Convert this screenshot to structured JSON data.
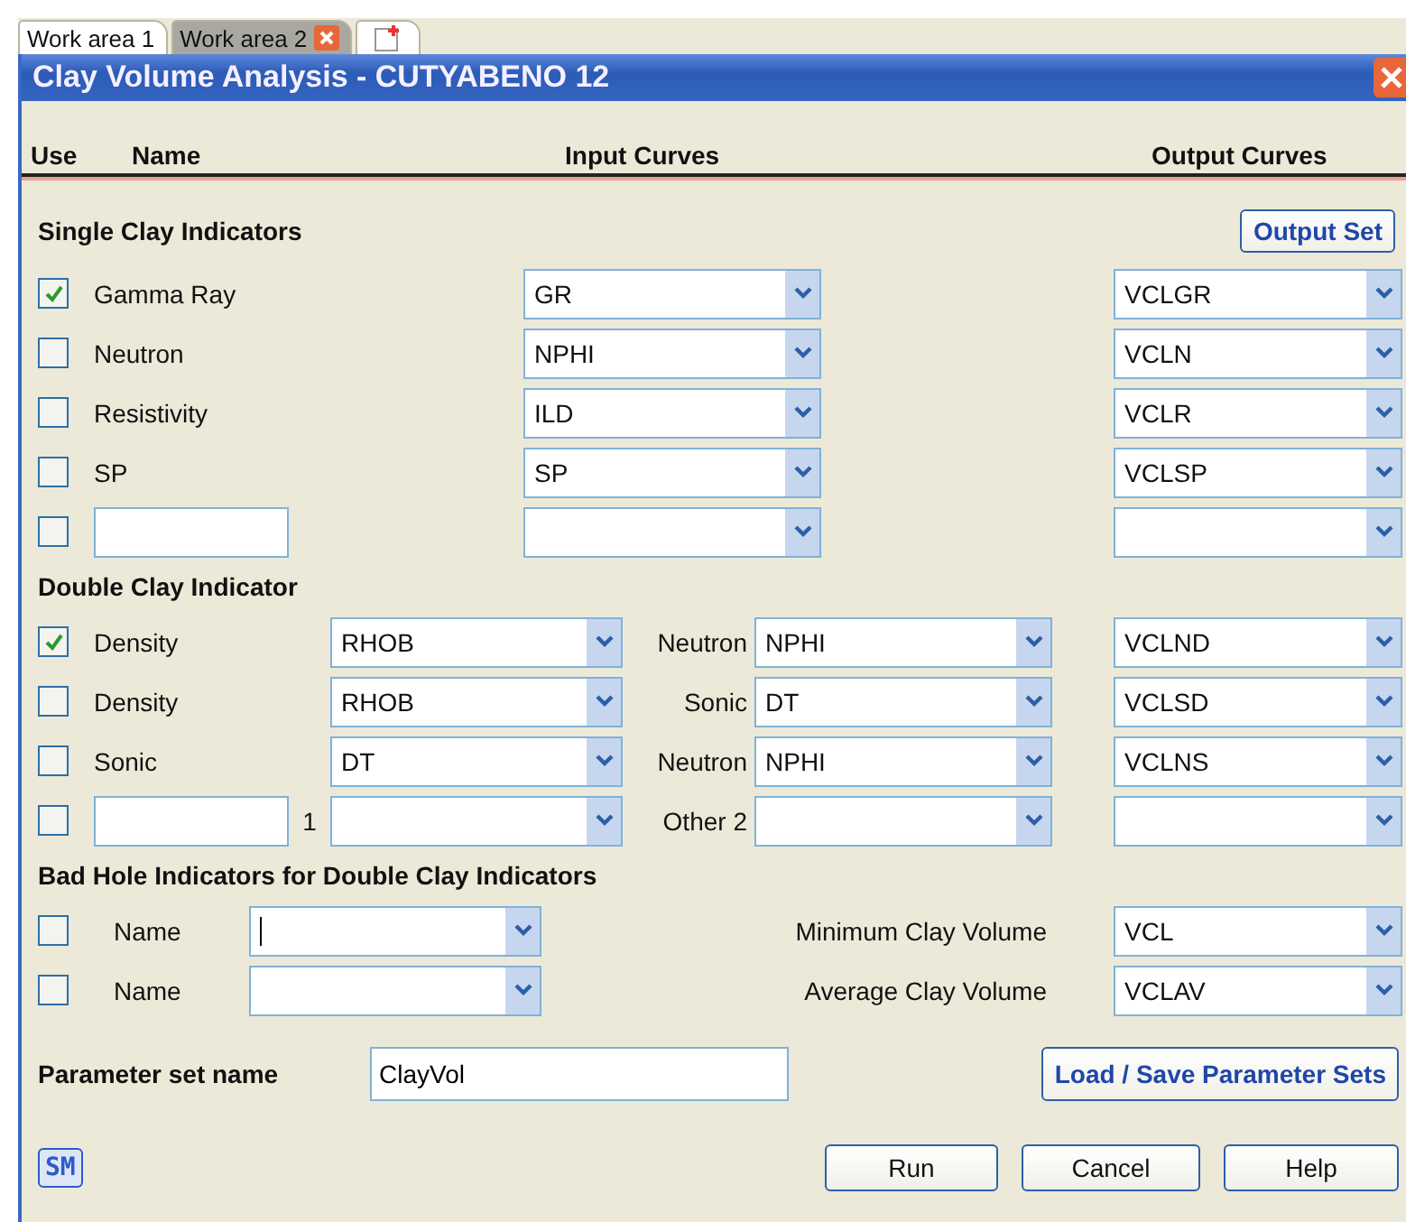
{
  "tabs": [
    {
      "label": "Work area 1",
      "selected": false,
      "closable": false
    },
    {
      "label": "Work area 2",
      "selected": true,
      "closable": true
    }
  ],
  "dialog": {
    "title": "Clay Volume Analysis - CUTYABENO 12",
    "columns": [
      "Use",
      "Name",
      "Input Curves",
      "Output Curves"
    ],
    "single": {
      "title": "Single Clay Indicators",
      "button": "Output Set",
      "rows": [
        {
          "kind": "preset",
          "checked": true,
          "name": "Gamma Ray",
          "input": "GR",
          "output": "VCLGR"
        },
        {
          "kind": "preset",
          "checked": false,
          "name": "Neutron",
          "input": "NPHI",
          "output": "VCLN"
        },
        {
          "kind": "preset",
          "checked": false,
          "name": "Resistivity",
          "input": "ILD",
          "output": "VCLR"
        },
        {
          "kind": "preset",
          "checked": false,
          "name": "SP",
          "input": "SP",
          "output": "VCLSP"
        },
        {
          "kind": "custom",
          "checked": false
        }
      ]
    },
    "double": {
      "title": "Double Clay Indicator",
      "rows": [
        {
          "kind": "preset",
          "checked": true,
          "name": "Density",
          "input1": "RHOB",
          "label2": "Neutron",
          "input2": "NPHI",
          "output": "VCLND"
        },
        {
          "kind": "preset",
          "checked": false,
          "name": "Density",
          "input1": "RHOB",
          "label2": "Sonic",
          "input2": "DT",
          "output": "VCLSD"
        },
        {
          "kind": "preset",
          "checked": false,
          "name": "Sonic",
          "input1": "DT",
          "label2": "Neutron",
          "input2": "NPHI",
          "output": "VCLNS"
        },
        {
          "kind": "custom",
          "checked": false,
          "suffix": "1",
          "label2": "Other 2"
        }
      ]
    },
    "bad_hole": {
      "title": "Bad Hole Indicators for Double Clay Indicators",
      "rows": [
        {
          "checked": false,
          "name": "Name",
          "focused": true,
          "output_label": "Minimum Clay Volume",
          "output": "VCL"
        },
        {
          "checked": false,
          "name": "Name",
          "focused": false,
          "output_label": "Average Clay Volume",
          "output": "VCLAV"
        }
      ]
    },
    "parameter_set": {
      "label": "Parameter set name",
      "value": "ClayVol",
      "button": "Load / Save Parameter Sets"
    },
    "logo": "SM",
    "buttons": [
      "Run",
      "Cancel",
      "Help"
    ]
  }
}
